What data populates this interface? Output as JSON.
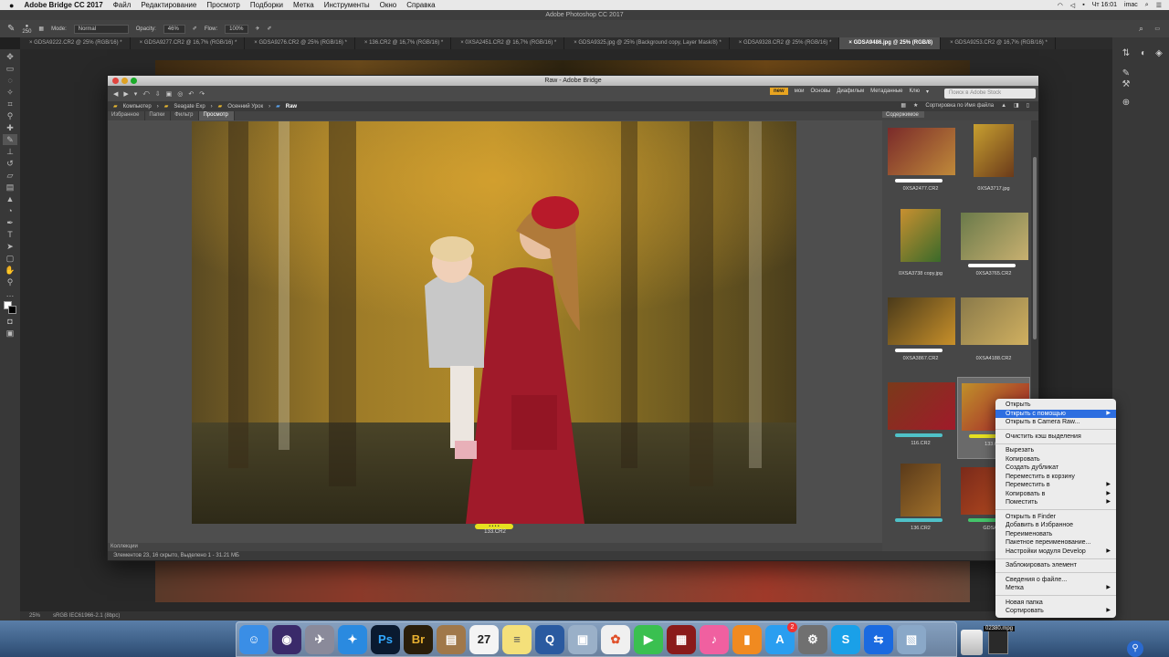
{
  "menubar": {
    "apple": "",
    "items": [
      "Adobe Bridge CC 2017",
      "Файл",
      "Редактирование",
      "Просмотр",
      "Подборки",
      "Метка",
      "Инструменты",
      "Окно",
      "Справка"
    ],
    "clock": "Чт 16:01",
    "user": "imac"
  },
  "photoshop": {
    "title": "Adobe Photoshop CC 2017",
    "options": {
      "brush_size": "250",
      "mode_label": "Mode:",
      "mode_value": "Normal",
      "opacity_label": "Opacity:",
      "opacity_value": "46%",
      "flow_label": "Flow:",
      "flow_value": "100%"
    },
    "tabs": [
      "GDSA9222.CR2 @ 25% (RGB/16) *",
      "GDSA9277.CR2 @ 16,7% (RGB/16) *",
      "GDSA9276.CR2 @ 25% (RGB/16) *",
      "136.CR2 @ 16,7% (RGB/16) *",
      "0XSA2451.CR2 @ 16,7% (RGB/16) *",
      "GDSA9325.jpg @ 25% (Background copy, Layer Mask/8) *",
      "GDSA9328.CR2 @ 25% (RGB/16) *",
      "GDSA9486.jpg @ 25% (RGB/8)",
      "GDSA9253.CR2 @ 16,7% (RGB/16) *"
    ],
    "active_tab": 7,
    "status": {
      "zoom": "25%",
      "profile": "sRGB IEC61966-2.1 (8bpc)"
    }
  },
  "bridge": {
    "title": "Raw - Adobe Bridge",
    "workspaces": {
      "active": "new",
      "items": [
        "мои",
        "Основы",
        "Диафильм",
        "Метаданные",
        "Клю"
      ]
    },
    "search_placeholder": "Поиск в Adobe Stock",
    "path": [
      "Компьютер",
      "Seagate Exp",
      "Осенний Урок",
      "Raw"
    ],
    "sort_label": "Сортировка по Имя файла",
    "panel_tabs": [
      "Избранное",
      "Папки",
      "Фильтр",
      "Просмотр"
    ],
    "active_panel_tab": 3,
    "preview_filename": "133.CR2",
    "preview_stars": "• • • •",
    "collections_tab": "Коллекции",
    "content_tab": "Содержимое",
    "status": "Элементов 23, 16 скрыто, Выделено 1 - 31.21 МБ",
    "thumbnails": [
      {
        "label": "0XSA2477.CR2",
        "bar": "#ffffff"
      },
      {
        "label": "0XSA3717.jpg",
        "bar": ""
      },
      {
        "label": "0XSA3738 copy.jpg",
        "bar": ""
      },
      {
        "label": "0XSA3765.CR2",
        "bar": "#ffffff"
      },
      {
        "label": "0XSA3867.CR2",
        "bar": "#ffffff"
      },
      {
        "label": "0XSA4188.CR2",
        "bar": ""
      },
      {
        "label": "116.CR2",
        "bar": "#4fc1c8"
      },
      {
        "label": "133.CR2",
        "bar": "#e6e020"
      },
      {
        "label": "136.CR2",
        "bar": "#4fc1c8"
      },
      {
        "label": "GDSA8...",
        "bar": "#44c46a"
      }
    ],
    "selected_thumbnail": 7
  },
  "context_menu": {
    "groups": [
      [
        {
          "label": "Открыть",
          "sub": false
        },
        {
          "label": "Открыть с помощью",
          "sub": true,
          "highlight": true
        },
        {
          "label": "Открыть в Camera Raw...",
          "sub": false
        }
      ],
      [
        {
          "label": "Очистить кэш выделения",
          "sub": false
        }
      ],
      [
        {
          "label": "Вырезать",
          "sub": false
        },
        {
          "label": "Копировать",
          "sub": false
        },
        {
          "label": "Создать дубликат",
          "sub": false
        },
        {
          "label": "Переместить в корзину",
          "sub": false
        },
        {
          "label": "Переместить в",
          "sub": true
        },
        {
          "label": "Копировать в",
          "sub": true
        },
        {
          "label": "Поместить",
          "sub": true
        }
      ],
      [
        {
          "label": "Открыть в Finder",
          "sub": false
        },
        {
          "label": "Добавить в Избранное",
          "sub": false
        },
        {
          "label": "Переименовать",
          "sub": false
        },
        {
          "label": "Пакетное переименование...",
          "sub": false
        },
        {
          "label": "Настройки модуля Develop",
          "sub": true
        }
      ],
      [
        {
          "label": "Заблокировать элемент",
          "sub": false
        }
      ],
      [
        {
          "label": "Сведения о файле...",
          "sub": false
        },
        {
          "label": "Метка",
          "sub": true
        }
      ],
      [
        {
          "label": "Новая папка",
          "sub": false
        },
        {
          "label": "Сортировать",
          "sub": true
        }
      ]
    ]
  },
  "dock": {
    "items": [
      {
        "name": "finder-icon",
        "glyph": "☺",
        "bg": "#3a8ee6"
      },
      {
        "name": "siri-icon",
        "glyph": "◉",
        "bg": "#3a2a6a"
      },
      {
        "name": "launchpad-icon",
        "glyph": "✈",
        "bg": "#8a8a9a"
      },
      {
        "name": "safari-icon",
        "glyph": "✦",
        "bg": "#2a8ae0"
      },
      {
        "name": "photoshop-icon",
        "glyph": "Ps",
        "bg": "#0a1a30"
      },
      {
        "name": "bridge-icon",
        "glyph": "Br",
        "bg": "#2a1e0a"
      },
      {
        "name": "contacts-icon",
        "glyph": "▤",
        "bg": "#a0784a"
      },
      {
        "name": "calendar-icon",
        "glyph": "27",
        "bg": "#f4f4f4"
      },
      {
        "name": "notes-icon",
        "glyph": "≡",
        "bg": "#f4e07a"
      },
      {
        "name": "quicktime-icon",
        "glyph": "Q",
        "bg": "#2a5aa0"
      },
      {
        "name": "preview-icon",
        "glyph": "▣",
        "bg": "#9ab0c8"
      },
      {
        "name": "photos-icon",
        "glyph": "✿",
        "bg": "#f0f0f0"
      },
      {
        "name": "facetime-icon",
        "glyph": "▶",
        "bg": "#3ac050"
      },
      {
        "name": "photobooth-icon",
        "glyph": "▦",
        "bg": "#8a1a1a"
      },
      {
        "name": "itunes-icon",
        "glyph": "♪",
        "bg": "#f060a0"
      },
      {
        "name": "ibooks-icon",
        "glyph": "▮",
        "bg": "#f08a20"
      },
      {
        "name": "appstore-icon",
        "glyph": "A",
        "bg": "#2a9ef0"
      },
      {
        "name": "system-preferences-icon",
        "glyph": "⚙",
        "bg": "#707070"
      },
      {
        "name": "skype-icon",
        "glyph": "S",
        "bg": "#1aa0e8"
      },
      {
        "name": "teamviewer-icon",
        "glyph": "⇆",
        "bg": "#1a6ae0"
      },
      {
        "name": "image-capture-icon",
        "glyph": "▧",
        "bg": "#8aa8c8"
      }
    ],
    "appstore_badge": "2",
    "file_label": "02380.mpg"
  },
  "colors": {
    "accent": "#2d6ee0",
    "workspace_active": "#e8a420"
  }
}
